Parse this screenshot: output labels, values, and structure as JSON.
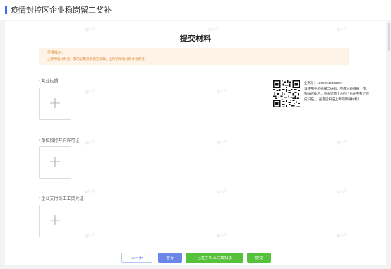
{
  "header": {
    "title": "疫情封控区企业稳岗留工奖补"
  },
  "page": {
    "title": "提交材料"
  },
  "notice": {
    "title": "重要提示：",
    "text": "上传附载材料后，我的必需重新提交驳稿，上传的附载材料才会保存。"
  },
  "fields": [
    {
      "label": "营业执照",
      "required": "*"
    },
    {
      "label": "单位银行开户许可证",
      "required": "*"
    },
    {
      "label": "企业支付员工工资凭证",
      "required": "*"
    }
  ],
  "upload": {
    "icon": "plus-icon",
    "glyph": "+"
  },
  "qr": {
    "business_no": "业务号：12022040800004",
    "lines": [
      "请使用手机扫描二维码，完成材料扫描上传。",
      "扫描完成后，点击页面下方的「已在手机上完",
      "成扫描」，查看已扫描上传的附载材料！"
    ]
  },
  "buttons": {
    "prev": "上一步",
    "save": "暂存",
    "done": "已在手机上完成扫描",
    "submit": "提交"
  },
  "watermark": "重庆市"
}
